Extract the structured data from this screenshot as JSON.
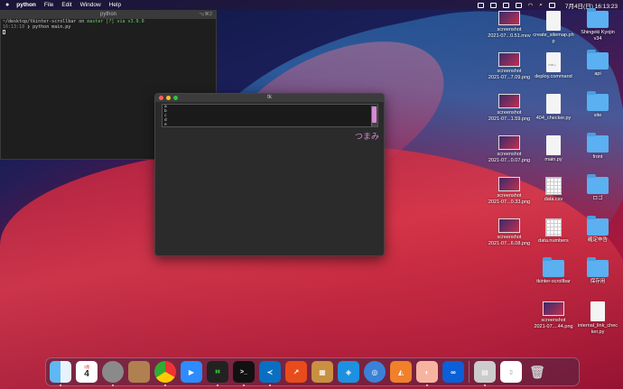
{
  "menubar": {
    "app": "python",
    "items": [
      "File",
      "Edit",
      "Window",
      "Help"
    ],
    "clock": "7月4日(日) 16:13:23"
  },
  "terminal": {
    "title": "python",
    "shortcut": "⌥⌘2",
    "prompt_path": "~/desktop/tkinter-scrollbar",
    "prompt_on": "on",
    "branch": "master [?] via",
    "version": "v3.9.0",
    "time": "16:13:18",
    "command": "python main.py"
  },
  "tk_window": {
    "title": "tk",
    "list_items": [
      "a",
      "b",
      "c",
      "d",
      "e"
    ],
    "knob_label": "つまみ",
    "thumb_color": "#d58ad5"
  },
  "desktop_icons": [
    {
      "name": "screenshot-1",
      "label1": "screenshot",
      "label2": "2021-07...0.51.mov",
      "kind": "shot"
    },
    {
      "name": "create-sitemap",
      "label1": "create_sitemap.ph",
      "label2": "p",
      "kind": "doc"
    },
    {
      "name": "shingeki-kyojin",
      "label1": "Shingeki Kyojin",
      "label2": "v34",
      "kind": "folder"
    },
    {
      "name": "screenshot-2",
      "label1": "screenshot",
      "label2": "2021-07...7.09.png",
      "kind": "shot"
    },
    {
      "name": "deploy-command",
      "label1": "deploy.command",
      "label2": "",
      "kind": "doc",
      "tag": "SHELL"
    },
    {
      "name": "api",
      "label1": "api",
      "label2": "",
      "kind": "folder"
    },
    {
      "name": "screenshot-3",
      "label1": "screenshot",
      "label2": "2021-07...1.59.png",
      "kind": "shot"
    },
    {
      "name": "404-checker",
      "label1": "404_checker.py",
      "label2": "",
      "kind": "doc"
    },
    {
      "name": "site",
      "label1": "site",
      "label2": "",
      "kind": "folder"
    },
    {
      "name": "screenshot-4",
      "label1": "screenshot",
      "label2": "2021-07...0.07.png",
      "kind": "shot"
    },
    {
      "name": "main-py",
      "label1": "main.py",
      "label2": "",
      "kind": "doc"
    },
    {
      "name": "front",
      "label1": "front",
      "label2": "",
      "kind": "folder"
    },
    {
      "name": "screenshot-5",
      "label1": "screenshot",
      "label2": "2021-07...0.33.png",
      "kind": "shot"
    },
    {
      "name": "data-csv",
      "label1": "data.csv",
      "label2": "",
      "kind": "sheet"
    },
    {
      "name": "logo",
      "label1": "ロゴ",
      "label2": "",
      "kind": "folder"
    },
    {
      "name": "screenshot-6",
      "label1": "screenshot",
      "label2": "2021-07...6.08.png",
      "kind": "shot"
    },
    {
      "name": "data-numbers",
      "label1": "data.numbers",
      "label2": "",
      "kind": "sheet"
    },
    {
      "name": "kakutei",
      "label1": "確定申告",
      "label2": "",
      "kind": "folder"
    },
    {
      "name": "tkinter-scrollbar",
      "label1": "tkinter-scrollbar",
      "label2": "",
      "kind": "folder"
    },
    {
      "name": "hozonyo",
      "label1": "保存用",
      "label2": "",
      "kind": "folder"
    },
    {
      "name": "screenshot-7",
      "label1": "screenshot",
      "label2": "2021-07....44.png",
      "kind": "shot"
    },
    {
      "name": "internal-link-checker",
      "label1": "internal_link_chec",
      "label2": "ker.py",
      "kind": "doc"
    }
  ],
  "dock": {
    "calendar_month": "7月",
    "calendar_day": "4",
    "terminal_glyph": ">_"
  }
}
